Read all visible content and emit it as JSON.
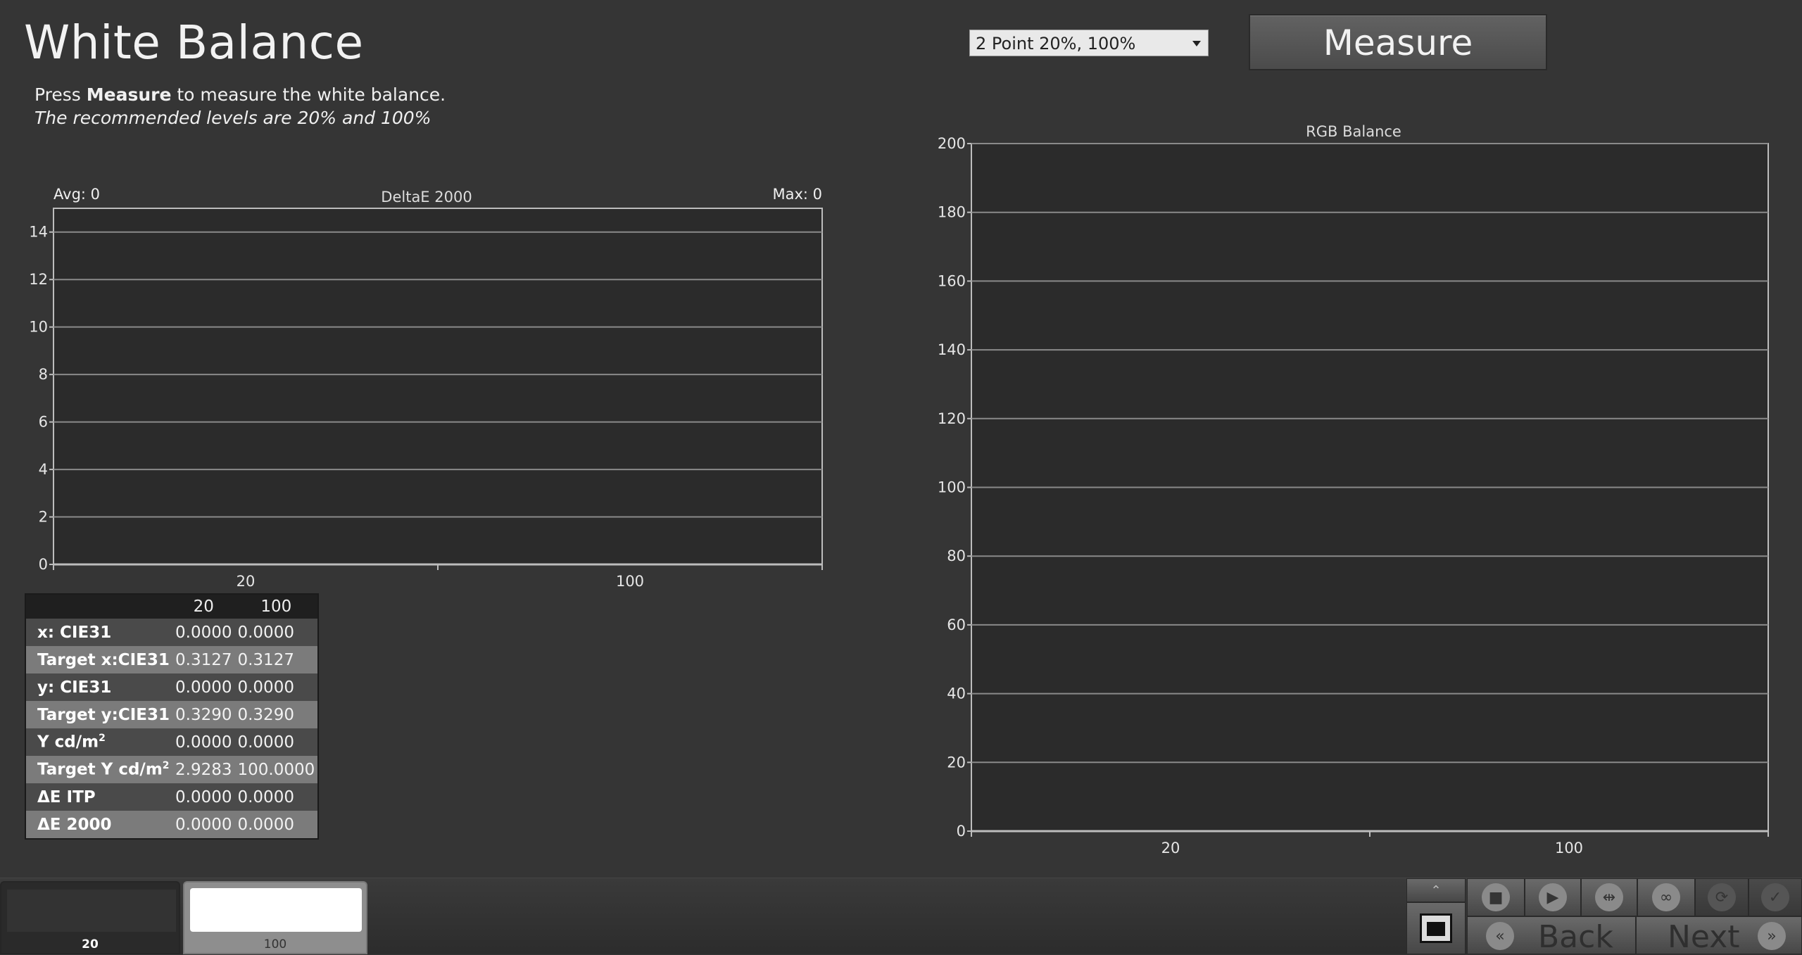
{
  "title": "White Balance",
  "instructions": {
    "prefix": "Press ",
    "bold": "Measure",
    "suffix": " to measure the white balance.",
    "note": "The recommended levels are 20% and 100%"
  },
  "mode_select": {
    "value": "2 Point 20%, 100%"
  },
  "measure_label": "Measure",
  "deltae_chart": {
    "title": "DeltaE 2000",
    "avg_label": "Avg: 0",
    "max_label": "Max: 0",
    "y_ticks": [
      "0",
      "2",
      "4",
      "6",
      "8",
      "10",
      "12",
      "14"
    ],
    "categories": [
      "20",
      "100"
    ]
  },
  "rgb_chart": {
    "title": "RGB Balance",
    "y_ticks": [
      "0",
      "20",
      "40",
      "60",
      "80",
      "100",
      "120",
      "140",
      "160",
      "180",
      "200"
    ],
    "categories": [
      "20",
      "100"
    ]
  },
  "chart_data": [
    {
      "type": "bar",
      "title": "DeltaE 2000",
      "categories": [
        "20",
        "100"
      ],
      "values": [],
      "ylim": [
        0,
        15
      ],
      "grid": true
    },
    {
      "type": "bar",
      "title": "RGB Balance",
      "categories": [
        "20",
        "100"
      ],
      "values": [],
      "ylim": [
        0,
        200
      ],
      "grid": true
    }
  ],
  "table": {
    "headers": [
      "",
      "20",
      "100"
    ],
    "rows": [
      {
        "label": "x: CIE31",
        "v20": "0.0000",
        "v100": "0.0000"
      },
      {
        "label": "Target x:CIE31",
        "v20": "0.3127",
        "v100": "0.3127"
      },
      {
        "label": "y: CIE31",
        "v20": "0.0000",
        "v100": "0.0000"
      },
      {
        "label": "Target y:CIE31",
        "v20": "0.3290",
        "v100": "0.3290"
      },
      {
        "label": "Y cd/m",
        "sup": "2",
        "v20": "0.0000",
        "v100": "0.0000"
      },
      {
        "label": "Target Y cd/m",
        "sup": "2",
        "v20": "2.9283",
        "v100": "100.0000"
      },
      {
        "label": "ΔE ITP",
        "v20": "0.0000",
        "v100": "0.0000"
      },
      {
        "label": "ΔE 2000",
        "v20": "0.0000",
        "v100": "0.0000"
      }
    ]
  },
  "thumbnails": [
    {
      "label": "20",
      "color": "#333333"
    },
    {
      "label": "100",
      "color": "#ffffff"
    }
  ],
  "controls": {
    "back_label": "Back",
    "next_label": "Next"
  }
}
